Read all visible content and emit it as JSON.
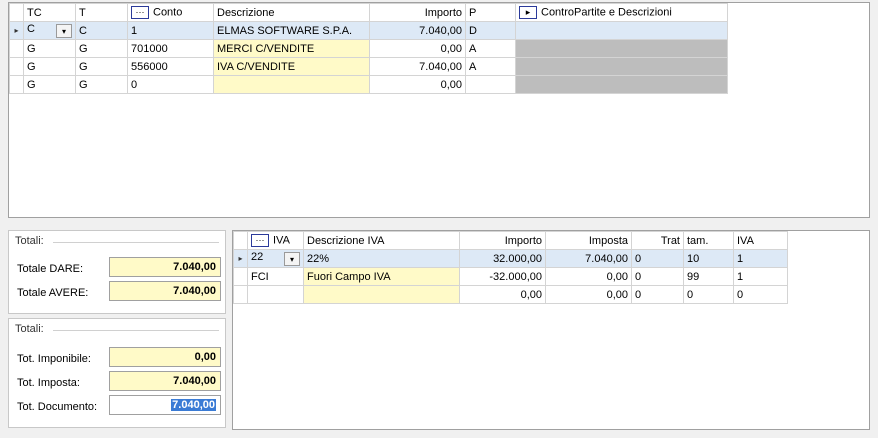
{
  "top_grid": {
    "headers": {
      "tc": "TC",
      "t": "T",
      "conto_btn": "···",
      "conto": "Conto",
      "descrizione": "Descrizione",
      "importo": "Importo",
      "p": "P",
      "contro_btn": "▸",
      "contropartite": "ControPartite e Descrizioni"
    },
    "rows": [
      {
        "tc": "C",
        "t": "C",
        "conto": "1",
        "descrizione": "ELMAS SOFTWARE S.P.A.",
        "importo": "7.040,00",
        "p": "D",
        "contropartite": ""
      },
      {
        "tc": "G",
        "t": "G",
        "conto": "701000",
        "descrizione": "MERCI C/VENDITE",
        "importo": "0,00",
        "p": "A",
        "contropartite": ""
      },
      {
        "tc": "G",
        "t": "G",
        "conto": "556000",
        "descrizione": "IVA C/VENDITE",
        "importo": "7.040,00",
        "p": "A",
        "contropartite": ""
      },
      {
        "tc": "G",
        "t": "G",
        "conto": "0",
        "descrizione": "",
        "importo": "0,00",
        "p": "",
        "contropartite": ""
      }
    ]
  },
  "totali1": {
    "title": "Totali:",
    "dare_label": "Totale DARE:",
    "dare_value": "7.040,00",
    "avere_label": "Totale AVERE:",
    "avere_value": "7.040,00"
  },
  "totali2": {
    "title": "Totali:",
    "imponibile_label": "Tot. Imponibile:",
    "imponibile_value": "0,00",
    "imposta_label": "Tot. Imposta:",
    "imposta_value": "7.040,00",
    "documento_label": "Tot. Documento:",
    "documento_value": "7.040,00"
  },
  "iva_grid": {
    "headers": {
      "btn": "···",
      "iva": "IVA",
      "descrizione": "Descrizione IVA",
      "importo": "Importo",
      "imposta": "Imposta",
      "trat": "Trat",
      "tam": "tam.",
      "iva2": "IVA"
    },
    "rows": [
      {
        "iva": "22",
        "descrizione": "22%",
        "importo": "32.000,00",
        "imposta": "7.040,00",
        "trat": "0",
        "tam": "10",
        "iva2": "1"
      },
      {
        "iva": "FCI",
        "descrizione": "Fuori Campo IVA",
        "importo": "-32.000,00",
        "imposta": "0,00",
        "trat": "0",
        "tam": "99",
        "iva2": "1"
      },
      {
        "iva": "",
        "descrizione": "",
        "importo": "0,00",
        "imposta": "0,00",
        "trat": "0",
        "tam": "0",
        "iva2": "0"
      }
    ]
  },
  "icons": {
    "row_indicator": "▸",
    "combo_arrow": "▾"
  },
  "colors": {
    "yellow_field": "#fffac8",
    "selected_row": "#dde9f6",
    "gray_cell": "#bdbdbd"
  }
}
